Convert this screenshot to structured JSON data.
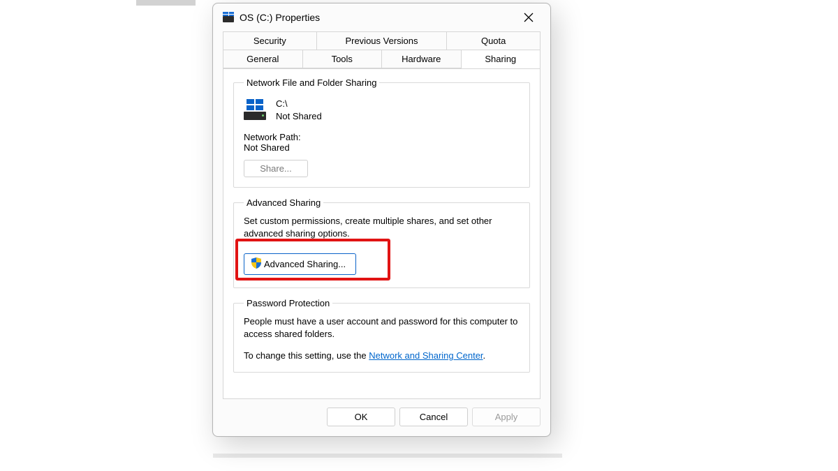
{
  "window": {
    "title": "OS (C:) Properties"
  },
  "tabs": {
    "row1": {
      "security": "Security",
      "previous": "Previous Versions",
      "quota": "Quota"
    },
    "row2": {
      "general": "General",
      "tools": "Tools",
      "hardware": "Hardware",
      "sharing": "Sharing"
    }
  },
  "network_sharing": {
    "legend": "Network File and Folder Sharing",
    "drive_path": "C:\\",
    "status": "Not Shared",
    "netpath_label": "Network Path:",
    "netpath_value": "Not Shared",
    "share_button": "Share..."
  },
  "advanced_sharing": {
    "legend": "Advanced Sharing",
    "desc": "Set custom permissions, create multiple shares, and set other advanced sharing options.",
    "button_label": "Advanced Sharing..."
  },
  "password_protection": {
    "legend": "Password Protection",
    "desc": "People must have a user account and password for this computer to access shared folders.",
    "change_prefix": "To change this setting, use the ",
    "link_text": "Network and Sharing Center",
    "period": "."
  },
  "footer": {
    "ok": "OK",
    "cancel": "Cancel",
    "apply": "Apply"
  }
}
